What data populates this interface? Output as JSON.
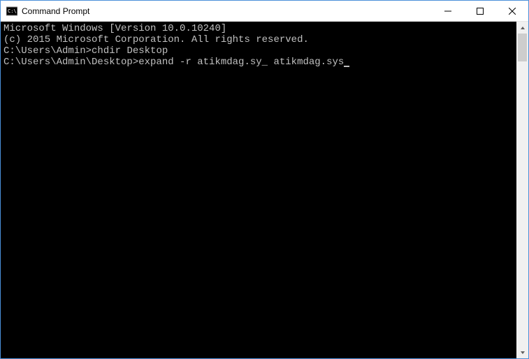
{
  "titlebar": {
    "title": "Command Prompt"
  },
  "terminal": {
    "line1": "Microsoft Windows [Version 10.0.10240]",
    "line2": "(c) 2015 Microsoft Corporation. All rights reserved.",
    "line3": "",
    "prompt1": "C:\\Users\\Admin>",
    "cmd1": "chdir Desktop",
    "line5": "",
    "prompt2": "C:\\Users\\Admin\\Desktop>",
    "cmd2": "expand -r atikmdag.sy_ atikmdag.sys"
  }
}
